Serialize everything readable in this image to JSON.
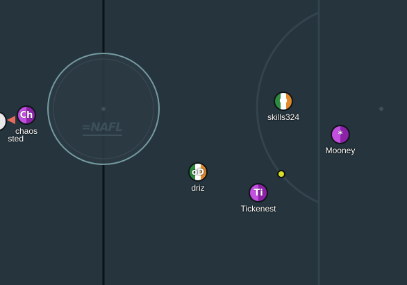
{
  "field": {
    "logo_text": "=NAFL",
    "colors": {
      "pitch": "#25343d",
      "line": "#34444e",
      "center_line": "#0c1216",
      "kickoff_circle": "#7fa7ad",
      "ball": "#d7df2a",
      "team_purple": "#c24fe0",
      "team_tricolor": [
        "#2d8a3e",
        "#ffffff",
        "#e08a2a"
      ],
      "pointer": "#e86a5b"
    }
  },
  "players": [
    {
      "name": "chaos",
      "avatar": "Ch",
      "team": "purple"
    },
    {
      "name": "skills324",
      "avatar": "",
      "team": "tricolor",
      "avatar_icon": "ring-icon"
    },
    {
      "name": "Mooney",
      "avatar": "*",
      "team": "purple"
    },
    {
      "name": "driz",
      "avatar": "oD",
      "team": "tricolor"
    },
    {
      "name": "Tickenest",
      "avatar": "Ti",
      "team": "purple"
    }
  ],
  "offscreen_player": {
    "name_fragment": "sted"
  }
}
